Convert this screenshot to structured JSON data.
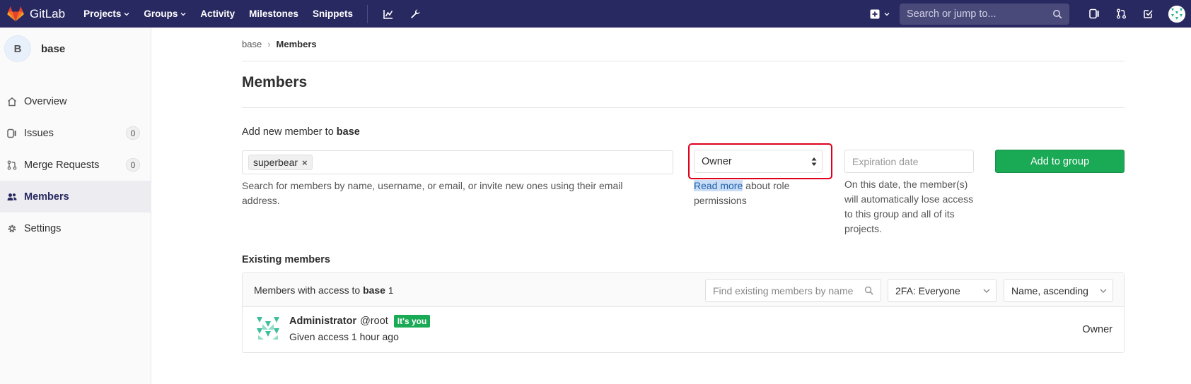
{
  "navbar": {
    "logo_text": "GitLab",
    "links": [
      "Projects",
      "Groups",
      "Activity",
      "Milestones",
      "Snippets"
    ],
    "search_placeholder": "Search or jump to...",
    "bg_color": "#292961"
  },
  "sidebar": {
    "group_avatar_letter": "B",
    "group_name": "base",
    "items": [
      {
        "label": "Overview",
        "icon": "home-icon"
      },
      {
        "label": "Issues",
        "icon": "issues-icon",
        "badge": "0"
      },
      {
        "label": "Merge Requests",
        "icon": "merge-request-icon",
        "badge": "0"
      },
      {
        "label": "Members",
        "icon": "members-icon",
        "active": true
      },
      {
        "label": "Settings",
        "icon": "gear-icon"
      }
    ]
  },
  "breadcrumb": {
    "parent": "base",
    "current": "Members"
  },
  "page_title": "Members",
  "add_member": {
    "label_prefix": "Add new member to ",
    "group": "base",
    "token": "superbear",
    "token_remove": "×",
    "help": "Search for members by name, username, or email, or invite new ones using their email address.",
    "role_value": "Owner",
    "role_help_link": "Read more",
    "role_help_rest": " about role permissions",
    "expiration_placeholder": "Expiration date",
    "expiration_help": "On this date, the member(s) will automatically lose access to this group and all of its projects.",
    "add_button": "Add to group",
    "accent_color": "#1aaa55"
  },
  "existing": {
    "title": "Existing members",
    "header_prefix": "Members with access to ",
    "header_group": "base",
    "count": "1",
    "find_placeholder": "Find existing members by name",
    "twofa_filter": "2FA: Everyone",
    "sort": "Name, ascending",
    "members": [
      {
        "name": "Administrator",
        "username": "@root",
        "badge": "It's you",
        "access": "Given access 1 hour ago",
        "role": "Owner"
      }
    ]
  }
}
